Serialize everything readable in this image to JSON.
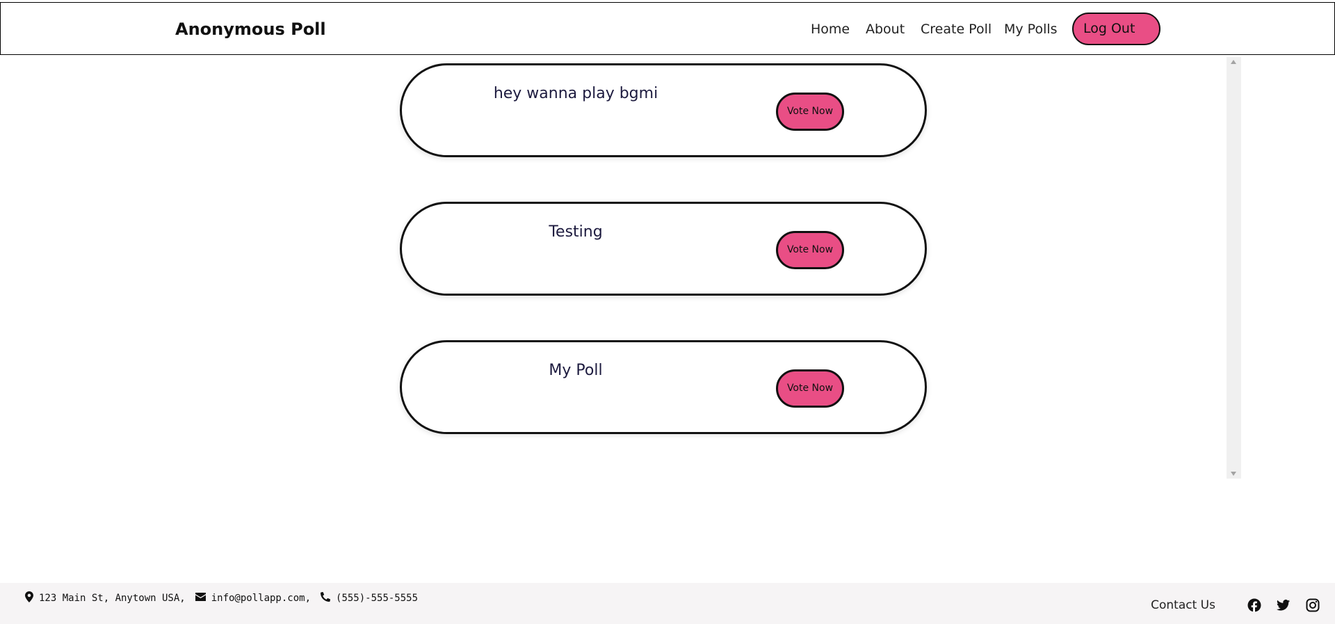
{
  "nav": {
    "brand": "Anonymous Poll",
    "links": [
      "Home",
      "About",
      "Create Poll",
      "My Polls"
    ],
    "logout_label": "Log Out"
  },
  "polls": [
    {
      "title": "hey wanna play bgmi",
      "button": "Vote Now"
    },
    {
      "title": "Testing",
      "button": "Vote Now"
    },
    {
      "title": "My Poll",
      "button": "Vote Now"
    }
  ],
  "footer": {
    "address": "123 Main St, Anytown USA,",
    "email": "info@pollapp.com,",
    "phone": "(555)-555-5555",
    "contact_us": "Contact Us",
    "social_icons": [
      "facebook-icon",
      "twitter-icon",
      "instagram-icon"
    ]
  },
  "colors": {
    "accent": "#e94e85",
    "footer_bg": "#f6f4f5",
    "poll_text": "#1d1b3f"
  }
}
